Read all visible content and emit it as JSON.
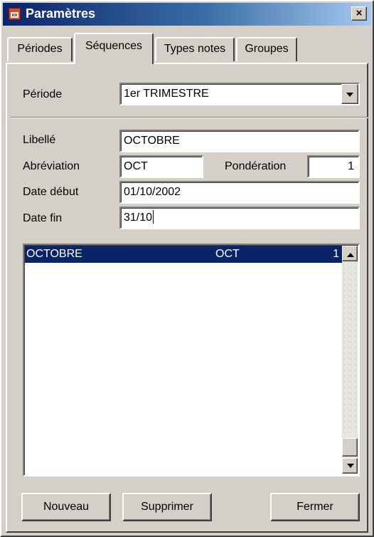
{
  "window": {
    "title": "Paramètres",
    "close_label": "×"
  },
  "tabs": [
    {
      "label": "Périodes",
      "active": false
    },
    {
      "label": "Séquences",
      "active": true
    },
    {
      "label": "Types notes",
      "active": false
    },
    {
      "label": "Groupes",
      "active": false
    }
  ],
  "periode": {
    "label": "Période",
    "value": "1er TRIMESTRE"
  },
  "form": {
    "libelle_label": "Libellé",
    "libelle_value": "OCTOBRE",
    "abreviation_label": "Abréviation",
    "abreviation_value": "OCT",
    "ponderation_label": "Pondération",
    "ponderation_value": "1",
    "date_debut_label": "Date début",
    "date_debut_value": "01/10/2002",
    "date_fin_label": "Date fin",
    "date_fin_value": "31/10"
  },
  "list": {
    "rows": [
      {
        "libelle": "OCTOBRE",
        "abreviation": "OCT",
        "ponderation": "1",
        "selected": true
      }
    ]
  },
  "buttons": {
    "nouveau": "Nouveau",
    "supprimer": "Supprimer",
    "fermer": "Fermer"
  },
  "colors": {
    "face": "#d4d0c8",
    "title_start": "#0a246a",
    "title_end": "#a6caf0",
    "selection": "#0a246a"
  }
}
